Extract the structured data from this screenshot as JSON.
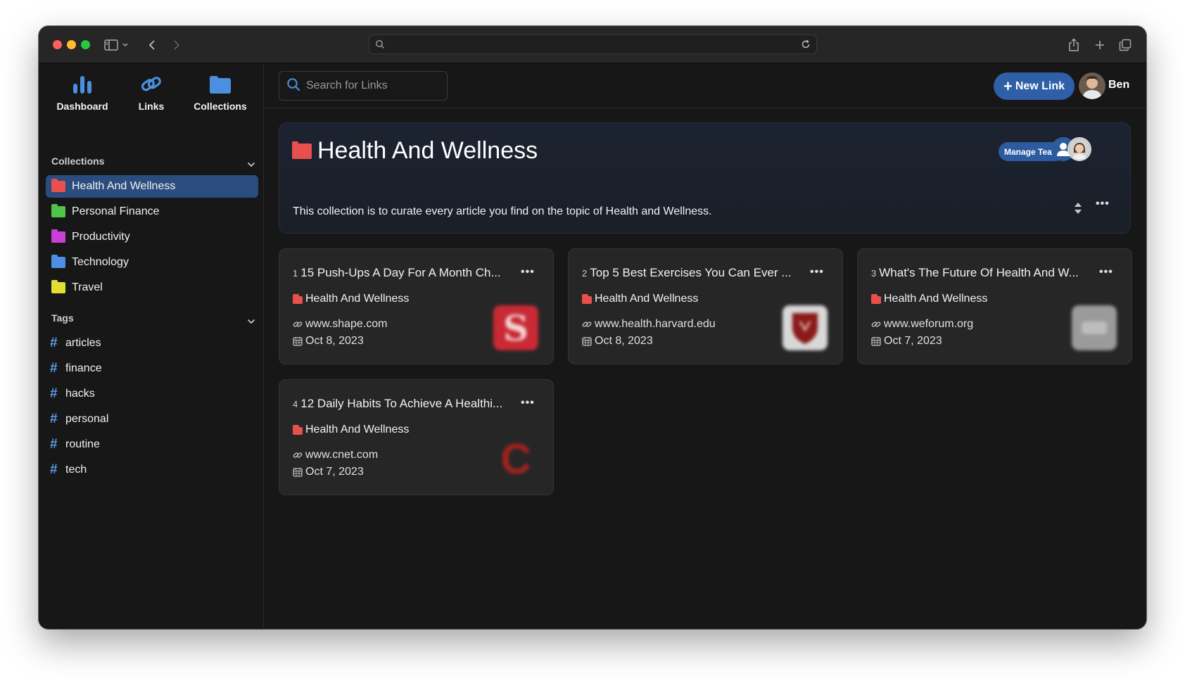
{
  "browser": {
    "url": ""
  },
  "nav": {
    "dashboard": "Dashboard",
    "links": "Links",
    "collections": "Collections"
  },
  "sidebar": {
    "collections_heading": "Collections",
    "collections": [
      {
        "label": "Health And Wellness",
        "color": "#e8504d",
        "active": true
      },
      {
        "label": "Personal Finance",
        "color": "#4fc44a",
        "active": false
      },
      {
        "label": "Productivity",
        "color": "#c940d6",
        "active": false
      },
      {
        "label": "Technology",
        "color": "#4d8fe3",
        "active": false
      },
      {
        "label": "Travel",
        "color": "#e3de35",
        "active": false
      }
    ],
    "tags_heading": "Tags",
    "tags": [
      "articles",
      "finance",
      "hacks",
      "personal",
      "routine",
      "tech"
    ]
  },
  "header": {
    "search_placeholder": "Search for Links",
    "new_link": "New Link",
    "user_name": "Ben"
  },
  "collection": {
    "title": "Health And Wellness",
    "color": "#e8504d",
    "manage_team": "Manage Team",
    "description": "This collection is to curate every article you find on the topic of Health and Wellness."
  },
  "links": [
    {
      "index": "1",
      "title": "15 Push-Ups A Day For A Month Ch...",
      "collection": "Health And Wellness",
      "url": "www.shape.com",
      "date": "Oct 8, 2023",
      "thumb_letter": "S",
      "thumb_bg": "#c92a35",
      "thumb_fg": "#f4d4d4"
    },
    {
      "index": "2",
      "title": "Top 5 Best Exercises You Can Ever ...",
      "collection": "Health And Wellness",
      "url": "www.health.harvard.edu",
      "date": "Oct 8, 2023",
      "thumb_letter": "",
      "thumb_bg": "#d8d8d8",
      "thumb_fg": "#8b1a1a"
    },
    {
      "index": "3",
      "title": "What's The Future Of Health And W...",
      "collection": "Health And Wellness",
      "url": "www.weforum.org",
      "date": "Oct 7, 2023",
      "thumb_letter": "",
      "thumb_bg": "#9b9b9b",
      "thumb_fg": "#bdbdbd"
    },
    {
      "index": "4",
      "title": "12 Daily Habits To Achieve A Healthi...",
      "collection": "Health And Wellness",
      "url": "www.cnet.com",
      "date": "Oct 7, 2023",
      "thumb_letter": "C",
      "thumb_bg": "#262626",
      "thumb_fg": "#a0231c"
    }
  ],
  "colors": {
    "accent": "#2f5fa7",
    "active_item": "#2b4c7e",
    "background": "#171717",
    "card": "#262626"
  }
}
